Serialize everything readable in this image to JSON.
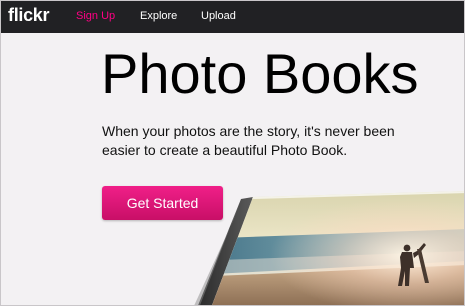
{
  "header": {
    "logo": "flickr",
    "nav": {
      "sign_up": "Sign Up",
      "explore": "Explore",
      "upload": "Upload"
    }
  },
  "hero": {
    "title": "Photo Books",
    "subtitle": "When your photos are the story, it's never been easier to create a beautiful Photo Book.",
    "cta_label": "Get Started"
  },
  "colors": {
    "brand_pink": "#ff0084",
    "navbar_bg": "#212124",
    "button_pink": "#e0187a"
  }
}
